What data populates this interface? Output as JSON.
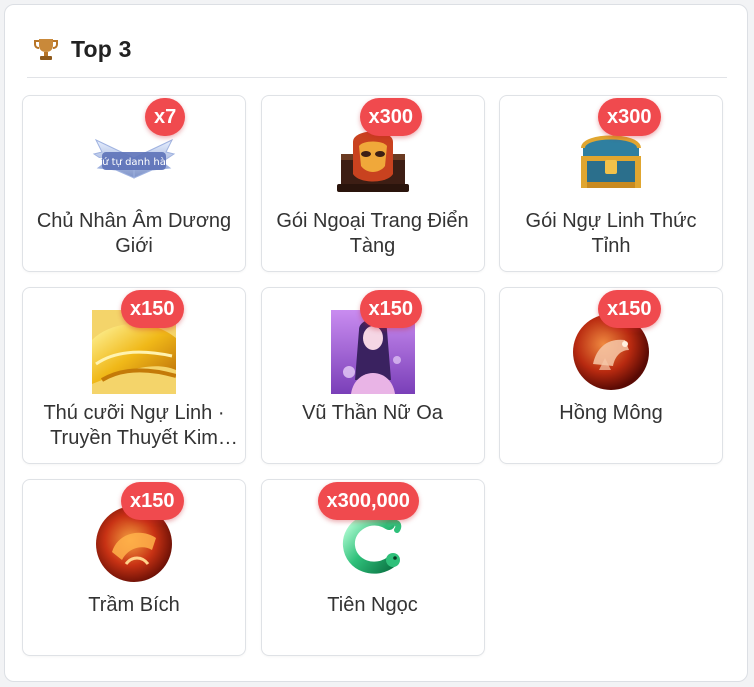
{
  "header": {
    "title": "Top 3",
    "icon": "trophy-icon"
  },
  "items": [
    {
      "name": "Chủ Nhân Âm Dương Giới",
      "qty": "x7",
      "icon": "winged-title-emblem",
      "thumb_text": "Tứ tự danh hào"
    },
    {
      "name": "Gói Ngoại Trang Điển Tàng",
      "qty": "x300",
      "icon": "mask-chest"
    },
    {
      "name": "Gói Ngự Linh Thức Tỉnh",
      "qty": "x300",
      "icon": "treasure-chest"
    },
    {
      "name": "Thú cưỡi Ngự Linh · Truyền Thuyết Kim Long",
      "qty": "x150",
      "icon": "golden-mount"
    },
    {
      "name": "Vũ Thần Nữ Oa",
      "qty": "x150",
      "icon": "goddess-portrait"
    },
    {
      "name": "Hồng Mông",
      "qty": "x150",
      "icon": "red-beast-orb"
    },
    {
      "name": "Trầm Bích",
      "qty": "x150",
      "icon": "red-beast-orb"
    },
    {
      "name": "Tiên Ngọc",
      "qty": "x300,000",
      "icon": "jade-serpent"
    }
  ],
  "colors": {
    "badge": "#f04a4e",
    "text": "#333333",
    "border": "#dfe2e6"
  }
}
